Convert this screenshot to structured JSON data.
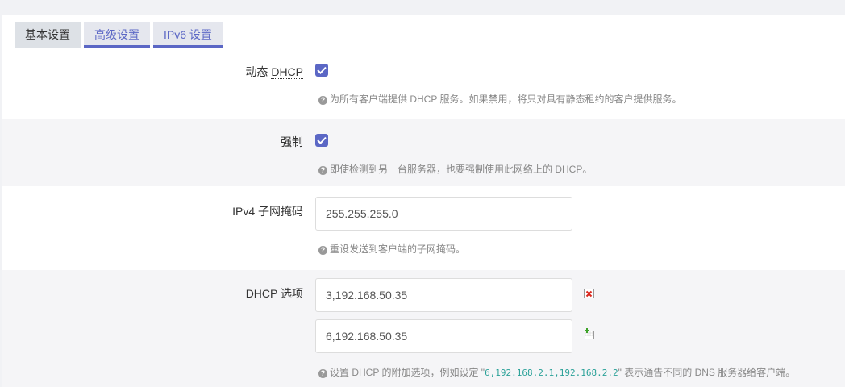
{
  "tabs": [
    "基本设置",
    "高级设置",
    "IPv6 设置"
  ],
  "fields": {
    "dynamic_dhcp": {
      "label_prefix": "动态 ",
      "label_abbr": "DHCP",
      "checked": true,
      "help": "为所有客户端提供 DHCP 服务。如果禁用，将只对具有静态租约的客户提供服务。"
    },
    "force": {
      "label": "强制",
      "checked": true,
      "help": "即使检测到另一台服务器，也要强制使用此网络上的 DHCP。"
    },
    "netmask": {
      "label_abbr": "IPv4",
      "label_suffix": " 子网掩码",
      "value": "255.255.255.0",
      "help": "重设发送到客户端的子网掩码。"
    },
    "dhcp_options": {
      "label": "DHCP 选项",
      "values": [
        "3,192.168.50.35",
        "6,192.168.50.35"
      ],
      "help_prefix": "设置 DHCP 的附加选项，例如设定 \"",
      "help_code": "6,192.168.2.1,192.168.2.2",
      "help_suffix": "\" 表示通告不同的 DNS 服务器给客户端。"
    }
  },
  "icons": {
    "help": "question-circle-icon",
    "remove": "remove-red-x-icon",
    "add": "add-green-plus-icon"
  },
  "colors": {
    "accent": "#5b67c5",
    "code": "#2aa198",
    "remove": "#d9261c",
    "add": "#3da329"
  }
}
